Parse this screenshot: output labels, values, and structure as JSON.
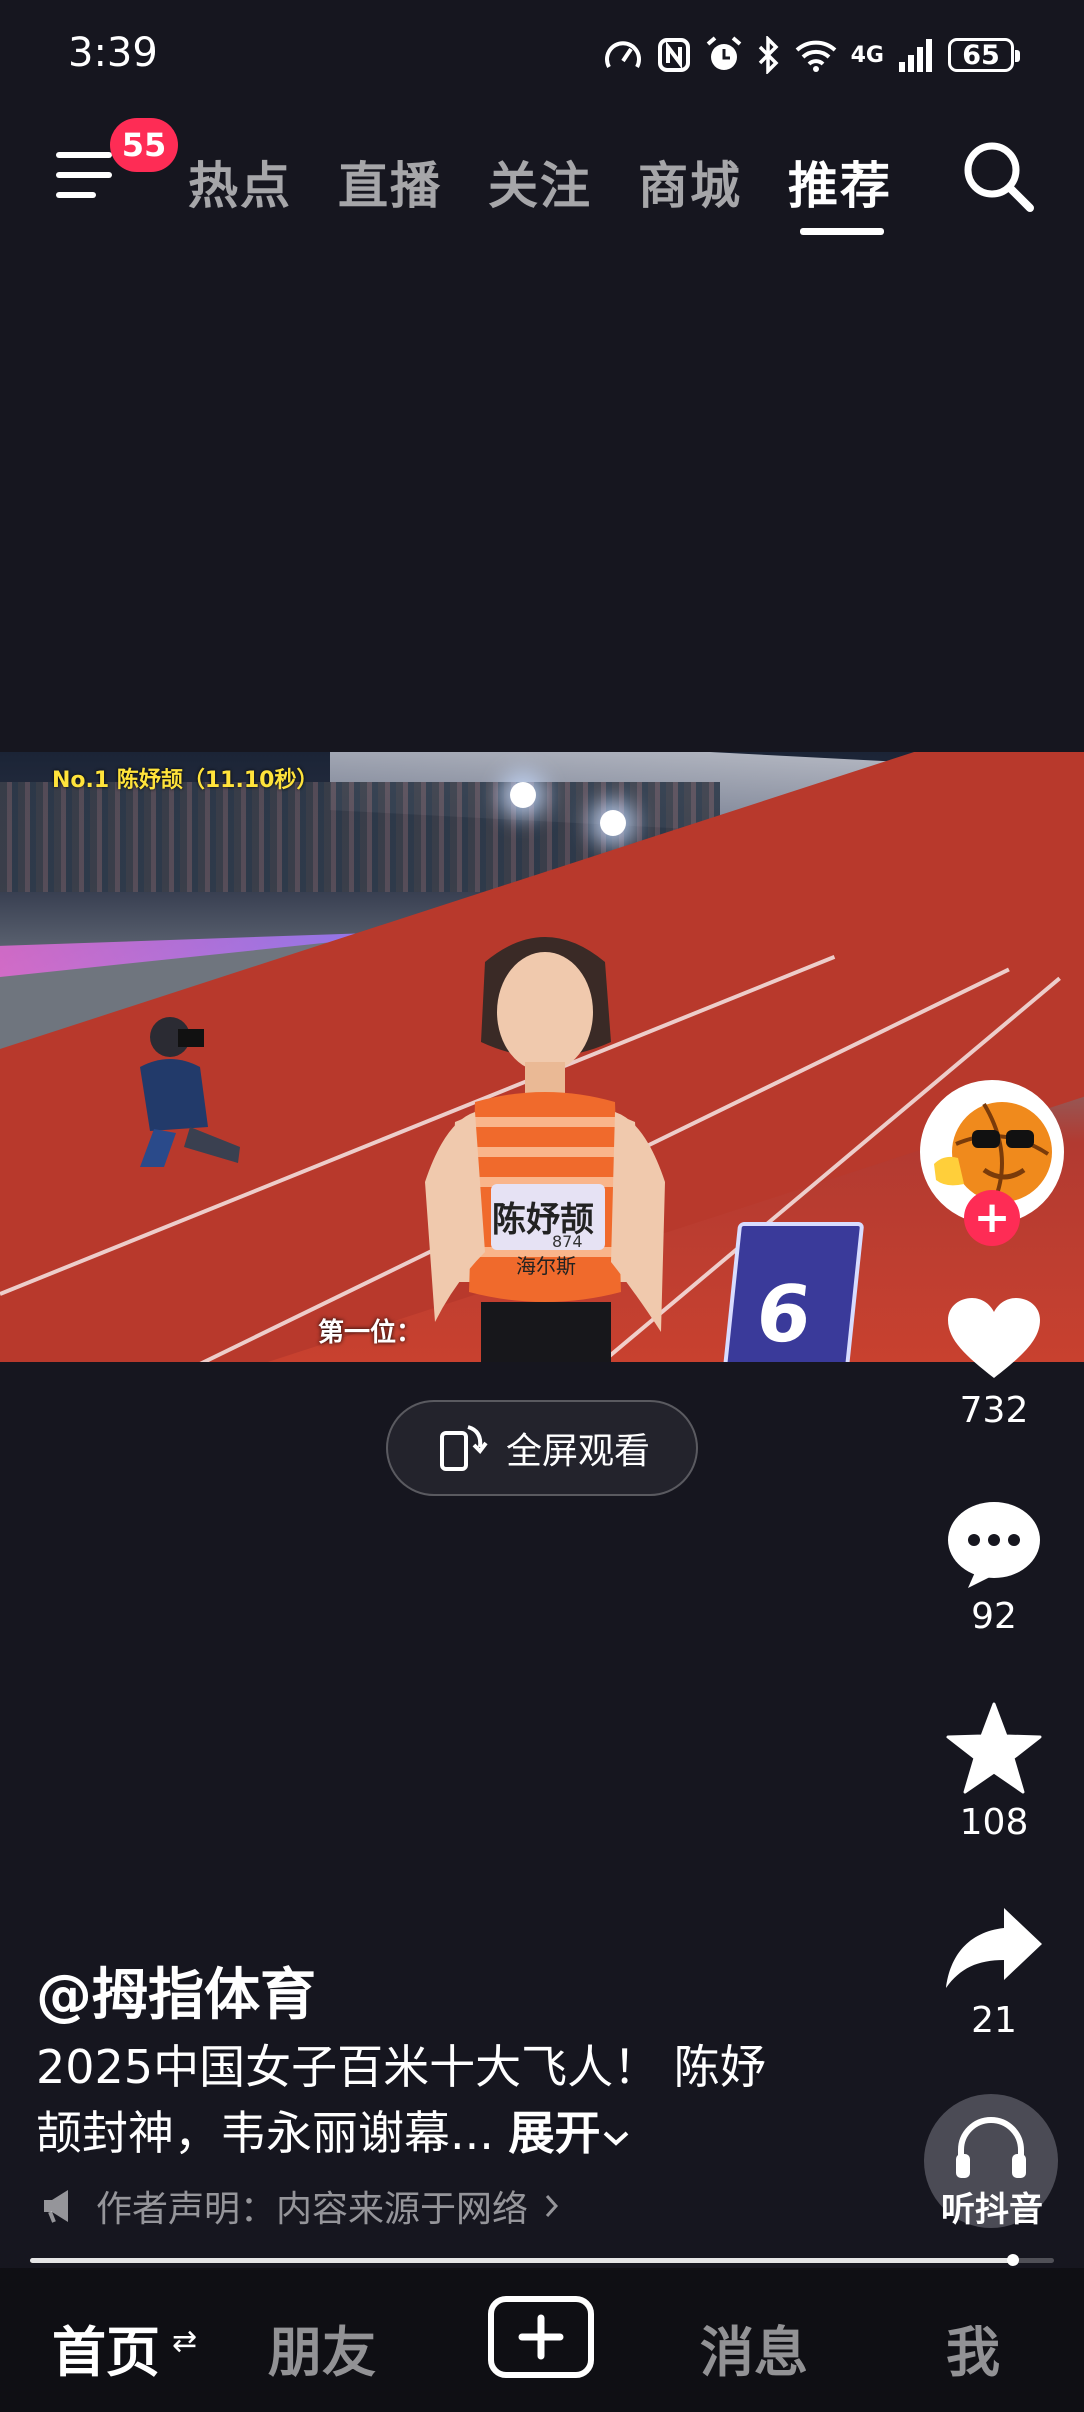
{
  "status_bar": {
    "time": "3:39",
    "network": "4G",
    "battery": "65"
  },
  "top_nav": {
    "menu_badge": "55",
    "tabs": [
      {
        "label": "热点"
      },
      {
        "label": "直播"
      },
      {
        "label": "关注"
      },
      {
        "label": "商城"
      },
      {
        "label": "推荐",
        "active": true
      }
    ]
  },
  "video": {
    "overlay_top": "No.1 陈妤颉（11.10秒）",
    "overlay_subtitle": "第一位：",
    "bib_name": "陈妤颉",
    "bib_number": "874",
    "bib_sponsor": "海尔斯",
    "lane_number": "6"
  },
  "fullscreen_button": {
    "label": "全屏观看"
  },
  "actions": {
    "likes": "732",
    "comments": "92",
    "favorites": "108",
    "shares": "21",
    "listen_label": "听抖音"
  },
  "caption": {
    "author": "@拇指体育",
    "description": "2025中国女子百米十大飞人！ 陈妤颉封神，韦永丽谢幕...",
    "expand_label": "展开",
    "disclaimer": "作者声明：内容来源于网络"
  },
  "playback": {
    "progress_fraction": 0.96
  },
  "bottom_nav": {
    "items": [
      {
        "label": "首页",
        "active": true
      },
      {
        "label": "朋友"
      },
      {
        "label": "消息"
      },
      {
        "label": "我"
      }
    ]
  },
  "colors": {
    "background": "#16161f",
    "accent": "#fe2c55"
  }
}
